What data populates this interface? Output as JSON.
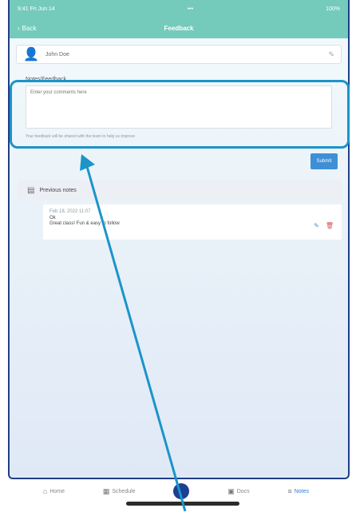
{
  "statusbar": {
    "time": "9:41 Fri Jun 14",
    "center": "•••",
    "battery": "100%"
  },
  "navbar": {
    "back_label": "Back",
    "title": "Feedback"
  },
  "namebar": {
    "name": "John Doe"
  },
  "notes": {
    "label": "Notes/Feedback",
    "placeholder": "Enter your comments here",
    "help": "Your feedback will be shared with the team to help us improve"
  },
  "submit_label": "Submit",
  "feedback_panel": {
    "title": "Previous notes"
  },
  "entry": {
    "meta": "Feb 18, 2022 11:07",
    "line1": "Ok",
    "line2": "Great class! Fun & easy to follow"
  },
  "tabs": [
    {
      "label": "Home",
      "icon": "home-icon"
    },
    {
      "label": "Schedule",
      "icon": "calendar-icon"
    },
    {
      "label": "",
      "icon": "center-action-icon"
    },
    {
      "label": "Docs",
      "icon": "document-icon"
    },
    {
      "label": "Notes",
      "icon": "notes-icon"
    }
  ],
  "colors": {
    "header": "#74cbbc",
    "highlight": "#1b94c9",
    "accent": "#3f8fd6"
  }
}
